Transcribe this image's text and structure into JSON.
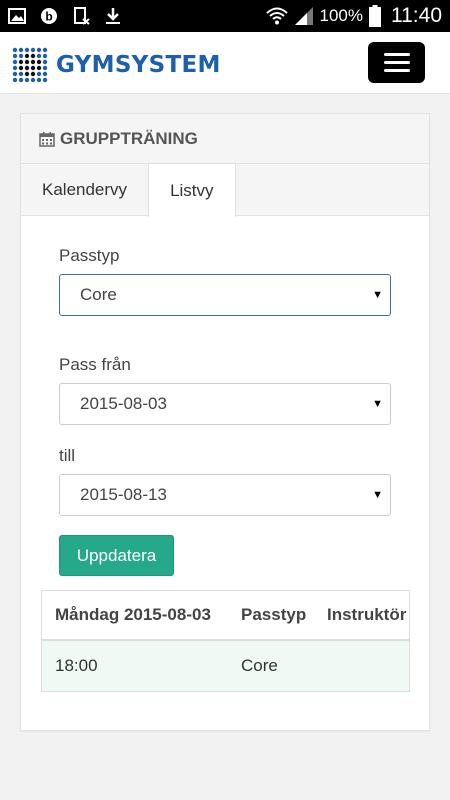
{
  "status_bar": {
    "battery": "100%",
    "time": "11:40",
    "left_icons": [
      "gallery-icon",
      "b-icon",
      "sim-icon",
      "download-icon"
    ],
    "right_icons": [
      "wifi-icon",
      "signal-icon",
      "battery-icon"
    ]
  },
  "header": {
    "logo_text": "GYMSYSTEM",
    "menu_icon": "hamburger-icon"
  },
  "panel": {
    "title": "GRUPPTRÄNING",
    "title_icon": "calendar-icon",
    "tabs": [
      {
        "label": "Kalendervy",
        "active": false
      },
      {
        "label": "Listvy",
        "active": true
      }
    ]
  },
  "form": {
    "passtyp_label": "Passtyp",
    "passtyp_value": "Core",
    "pass_fran_label": "Pass från",
    "pass_fran_value": "2015-08-03",
    "till_label": "till",
    "till_value": "2015-08-13",
    "update_button": "Uppdatera"
  },
  "table": {
    "headers": [
      "Måndag 2015-08-03",
      "Passtyp",
      "Instruktör"
    ],
    "rows": [
      [
        "18:00",
        "Core",
        ""
      ]
    ]
  },
  "colors": {
    "accent": "#26a88a",
    "brand": "#1d5fa8",
    "row_highlight": "#f0faf5"
  }
}
